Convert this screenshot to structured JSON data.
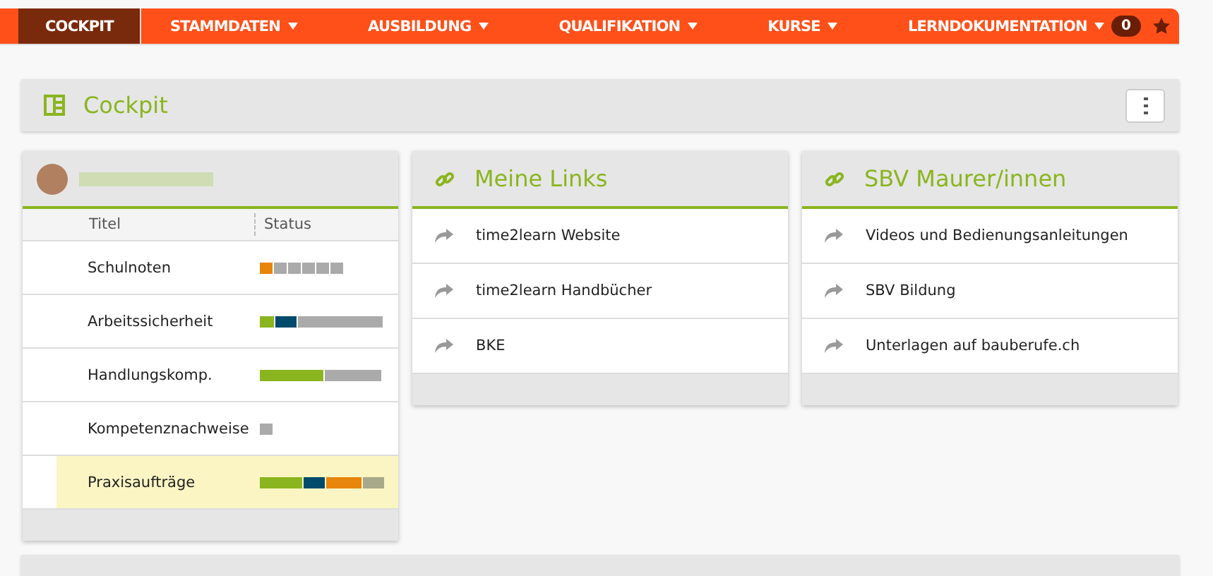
{
  "nav": {
    "items": [
      {
        "label": "COCKPIT",
        "selected": true,
        "dropdown": false
      },
      {
        "label": "STAMMDATEN",
        "selected": false,
        "dropdown": true
      },
      {
        "label": "AUSBILDUNG",
        "selected": false,
        "dropdown": true
      },
      {
        "label": "QUALIFIKATION",
        "selected": false,
        "dropdown": true
      },
      {
        "label": "KURSE",
        "selected": false,
        "dropdown": true
      },
      {
        "label": "LERNDOKUMENTATION",
        "selected": false,
        "dropdown": true
      }
    ],
    "badge": "0"
  },
  "page_title": "Cockpit",
  "status_card": {
    "columns": [
      "Titel",
      "Status"
    ],
    "rows": [
      {
        "title": "Schulnoten",
        "selected": false,
        "kind": "squares",
        "cells": [
          {
            "color": "#e8850c"
          },
          {
            "color": "#aaaaaa"
          },
          {
            "color": "#aaaaaa"
          },
          {
            "color": "#aaaaaa"
          },
          {
            "color": "#aaaaaa"
          },
          {
            "color": "#aaaaaa"
          }
        ]
      },
      {
        "title": "Arbeitssicherheit",
        "selected": false,
        "kind": "bar",
        "cells": [
          {
            "color": "#8ab51e"
          },
          {
            "color": "#8ab51e"
          },
          {
            "color": "#004b6b"
          },
          {
            "color": "#004b6b"
          },
          {
            "color": "#004b6b"
          },
          {
            "color": "#aaaaaa"
          },
          {
            "color": "#aaaaaa"
          },
          {
            "color": "#aaaaaa"
          },
          {
            "color": "#aaaaaa"
          },
          {
            "color": "#aaaaaa"
          },
          {
            "color": "#aaaaaa"
          },
          {
            "color": "#aaaaaa"
          },
          {
            "color": "#aaaaaa"
          },
          {
            "color": "#aaaaaa"
          },
          {
            "color": "#aaaaaa"
          },
          {
            "color": "#aaaaaa"
          },
          {
            "color": "#aaaaaa"
          }
        ]
      },
      {
        "title": "Handlungskomp.",
        "selected": false,
        "kind": "bar",
        "cells": [
          {
            "color": "#8ab51e"
          },
          {
            "color": "#8ab51e"
          },
          {
            "color": "#8ab51e"
          },
          {
            "color": "#8ab51e"
          },
          {
            "color": "#8ab51e"
          },
          {
            "color": "#8ab51e"
          },
          {
            "color": "#8ab51e"
          },
          {
            "color": "#8ab51e"
          },
          {
            "color": "#8ab51e"
          },
          {
            "color": "#aaaaaa"
          },
          {
            "color": "#aaaaaa"
          },
          {
            "color": "#aaaaaa"
          },
          {
            "color": "#aaaaaa"
          },
          {
            "color": "#aaaaaa"
          },
          {
            "color": "#aaaaaa"
          },
          {
            "color": "#aaaaaa"
          },
          {
            "color": "#aaaaaa"
          }
        ]
      },
      {
        "title": "Kompetenznachweise",
        "selected": false,
        "kind": "squares",
        "cells": [
          {
            "color": "#aaaaaa"
          }
        ]
      },
      {
        "title": "Praxisaufträge",
        "selected": true,
        "kind": "bar",
        "cells": [
          {
            "color": "#8ab51e"
          },
          {
            "color": "#8ab51e"
          },
          {
            "color": "#8ab51e"
          },
          {
            "color": "#8ab51e"
          },
          {
            "color": "#8ab51e"
          },
          {
            "color": "#8ab51e"
          },
          {
            "color": "#004b6b"
          },
          {
            "color": "#004b6b"
          },
          {
            "color": "#004b6b"
          },
          {
            "color": "#e8850c"
          },
          {
            "color": "#e8850c"
          },
          {
            "color": "#e8850c"
          },
          {
            "color": "#e8850c"
          },
          {
            "color": "#e8850c"
          },
          {
            "color": "#a8a88a"
          },
          {
            "color": "#a8a88a"
          },
          {
            "color": "#a8a88a"
          }
        ]
      }
    ]
  },
  "link_cards": [
    {
      "title": "Meine Links",
      "links": [
        "time2learn Website",
        "time2learn Handbücher",
        "BKE"
      ]
    },
    {
      "title": "SBV Maurer/innen",
      "links": [
        "Videos und Bedienungsanleitungen",
        "SBV Bildung",
        "Unterlagen auf bauberufe.ch"
      ]
    }
  ]
}
